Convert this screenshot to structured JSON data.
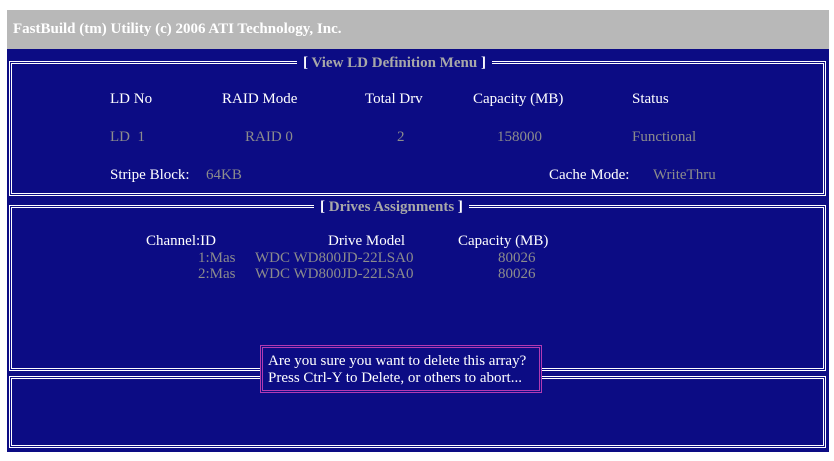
{
  "title": "FastBuild (tm) Utility (c) 2006 ATI Technology, Inc.",
  "ld_menu": {
    "heading": "View LD Definition Menu",
    "columns": [
      "LD No",
      "RAID Mode",
      "Total Drv",
      "Capacity (MB)",
      "Status"
    ],
    "row": {
      "ld_no": "LD  1",
      "raid_mode": "RAID 0",
      "total_drv": "2",
      "capacity": "158000",
      "status": "Functional"
    },
    "stripe_label": "Stripe Block:",
    "stripe_value": "64KB",
    "cache_label": "Cache Mode:",
    "cache_value": "WriteThru"
  },
  "drives": {
    "heading": "Drives Assignments",
    "columns": [
      "Channel:ID",
      "Drive Model",
      "Capacity (MB)"
    ],
    "rows": [
      {
        "channel": "1:Mas",
        "model": "WDC WD800JD-22LSA0",
        "capacity": "80026"
      },
      {
        "channel": "2:Mas",
        "model": "WDC WD800JD-22LSA0",
        "capacity": "80026"
      }
    ]
  },
  "dialog": {
    "line1": "Are you sure you want to delete this array?",
    "line2": "Press Ctrl-Y to Delete, or others to abort..."
  }
}
